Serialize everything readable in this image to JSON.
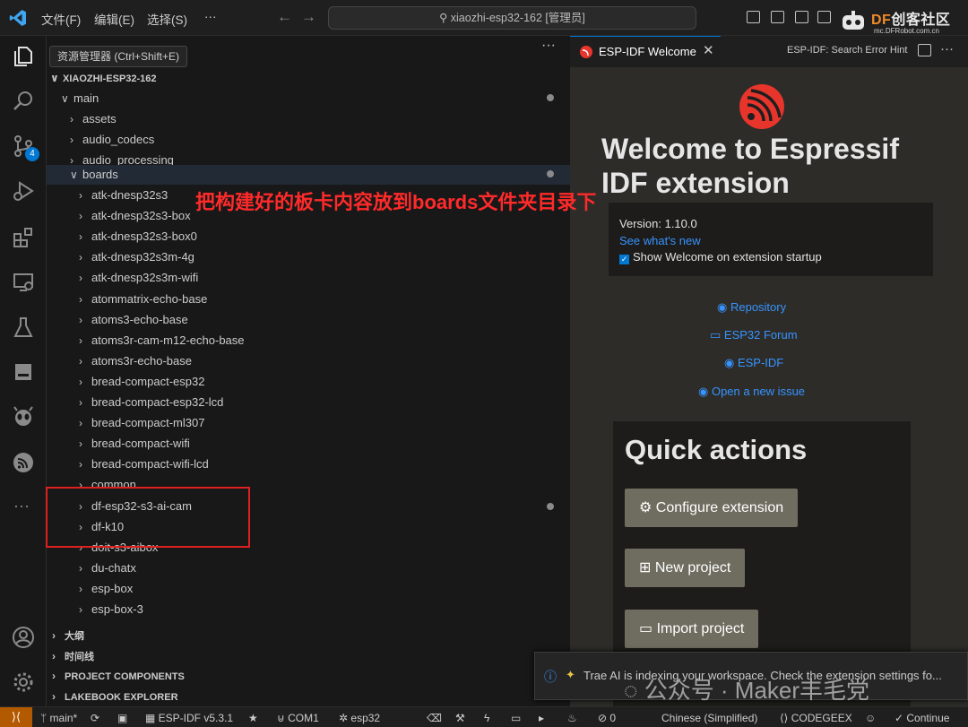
{
  "titlebar": {
    "menus": [
      "文件(F)",
      "编辑(E)",
      "选择(S)",
      "···"
    ],
    "search": "xiaozhi-esp32-162 [管理员]",
    "brand_df": "DF",
    "brand_cn": "创客社区",
    "brand_sub": "mc.DFRobot.com.cn"
  },
  "activitybar": {
    "scm_badge": "4"
  },
  "tooltip": "资源管理器 (Ctrl+Shift+E)",
  "sidebar": {
    "more": "···",
    "root": "XIAOZHI-ESP32-162",
    "main_folder": "main",
    "items_top": [
      "assets",
      "audio_codecs",
      "audio_processing"
    ],
    "boards_folder": "boards",
    "boards": [
      "atk-dnesp32s3",
      "atk-dnesp32s3-box",
      "atk-dnesp32s3-box0",
      "atk-dnesp32s3m-4g",
      "atk-dnesp32s3m-wifi",
      "atommatrix-echo-base",
      "atoms3-echo-base",
      "atoms3r-cam-m12-echo-base",
      "atoms3r-echo-base",
      "bread-compact-esp32",
      "bread-compact-esp32-lcd",
      "bread-compact-ml307",
      "bread-compact-wifi",
      "bread-compact-wifi-lcd",
      "common",
      "df-esp32-s3-ai-cam",
      "df-k10",
      "doit-s3-aibox",
      "du-chatx",
      "esp-box",
      "esp-box-3"
    ],
    "sections": [
      "大纲",
      "时间线",
      "PROJECT COMPONENTS",
      "LAKEBOOK EXPLORER"
    ]
  },
  "editor": {
    "tab_label": "ESP-IDF Welcome",
    "tab_close": "✕",
    "tab_right": "ESP-IDF: Search Error Hint",
    "title_line1": "Welcome to Espressif",
    "title_line2": "IDF extension",
    "version": "Version: 1.10.0",
    "whats_new": "See what's new",
    "show_welcome": "Show Welcome on extension startup",
    "links": [
      "Repository",
      "ESP32 Forum",
      "ESP-IDF",
      "Open a new issue"
    ],
    "quick_actions_title": "Quick actions",
    "buttons": [
      "Configure extension",
      "New project",
      "Import project"
    ]
  },
  "annotation": "把构建好的板卡内容放到boards文件夹目录下",
  "notification": "Trae AI is indexing your workspace. Check the extension settings fo...",
  "watermark": "公众号 · Maker丰毛党",
  "statusbar": {
    "branch": "main*",
    "idf": "ESP-IDF v5.3.1",
    "port": "COM1",
    "target": "esp32",
    "errors": "0",
    "language": "Chinese (Simplified)",
    "codegeex": "CODEGEEX",
    "continue": "Continue"
  },
  "colors": {
    "accent": "#0078d4",
    "annotation": "#ff2a2a",
    "link": "#3794ff",
    "espressif": "#e7352c"
  }
}
